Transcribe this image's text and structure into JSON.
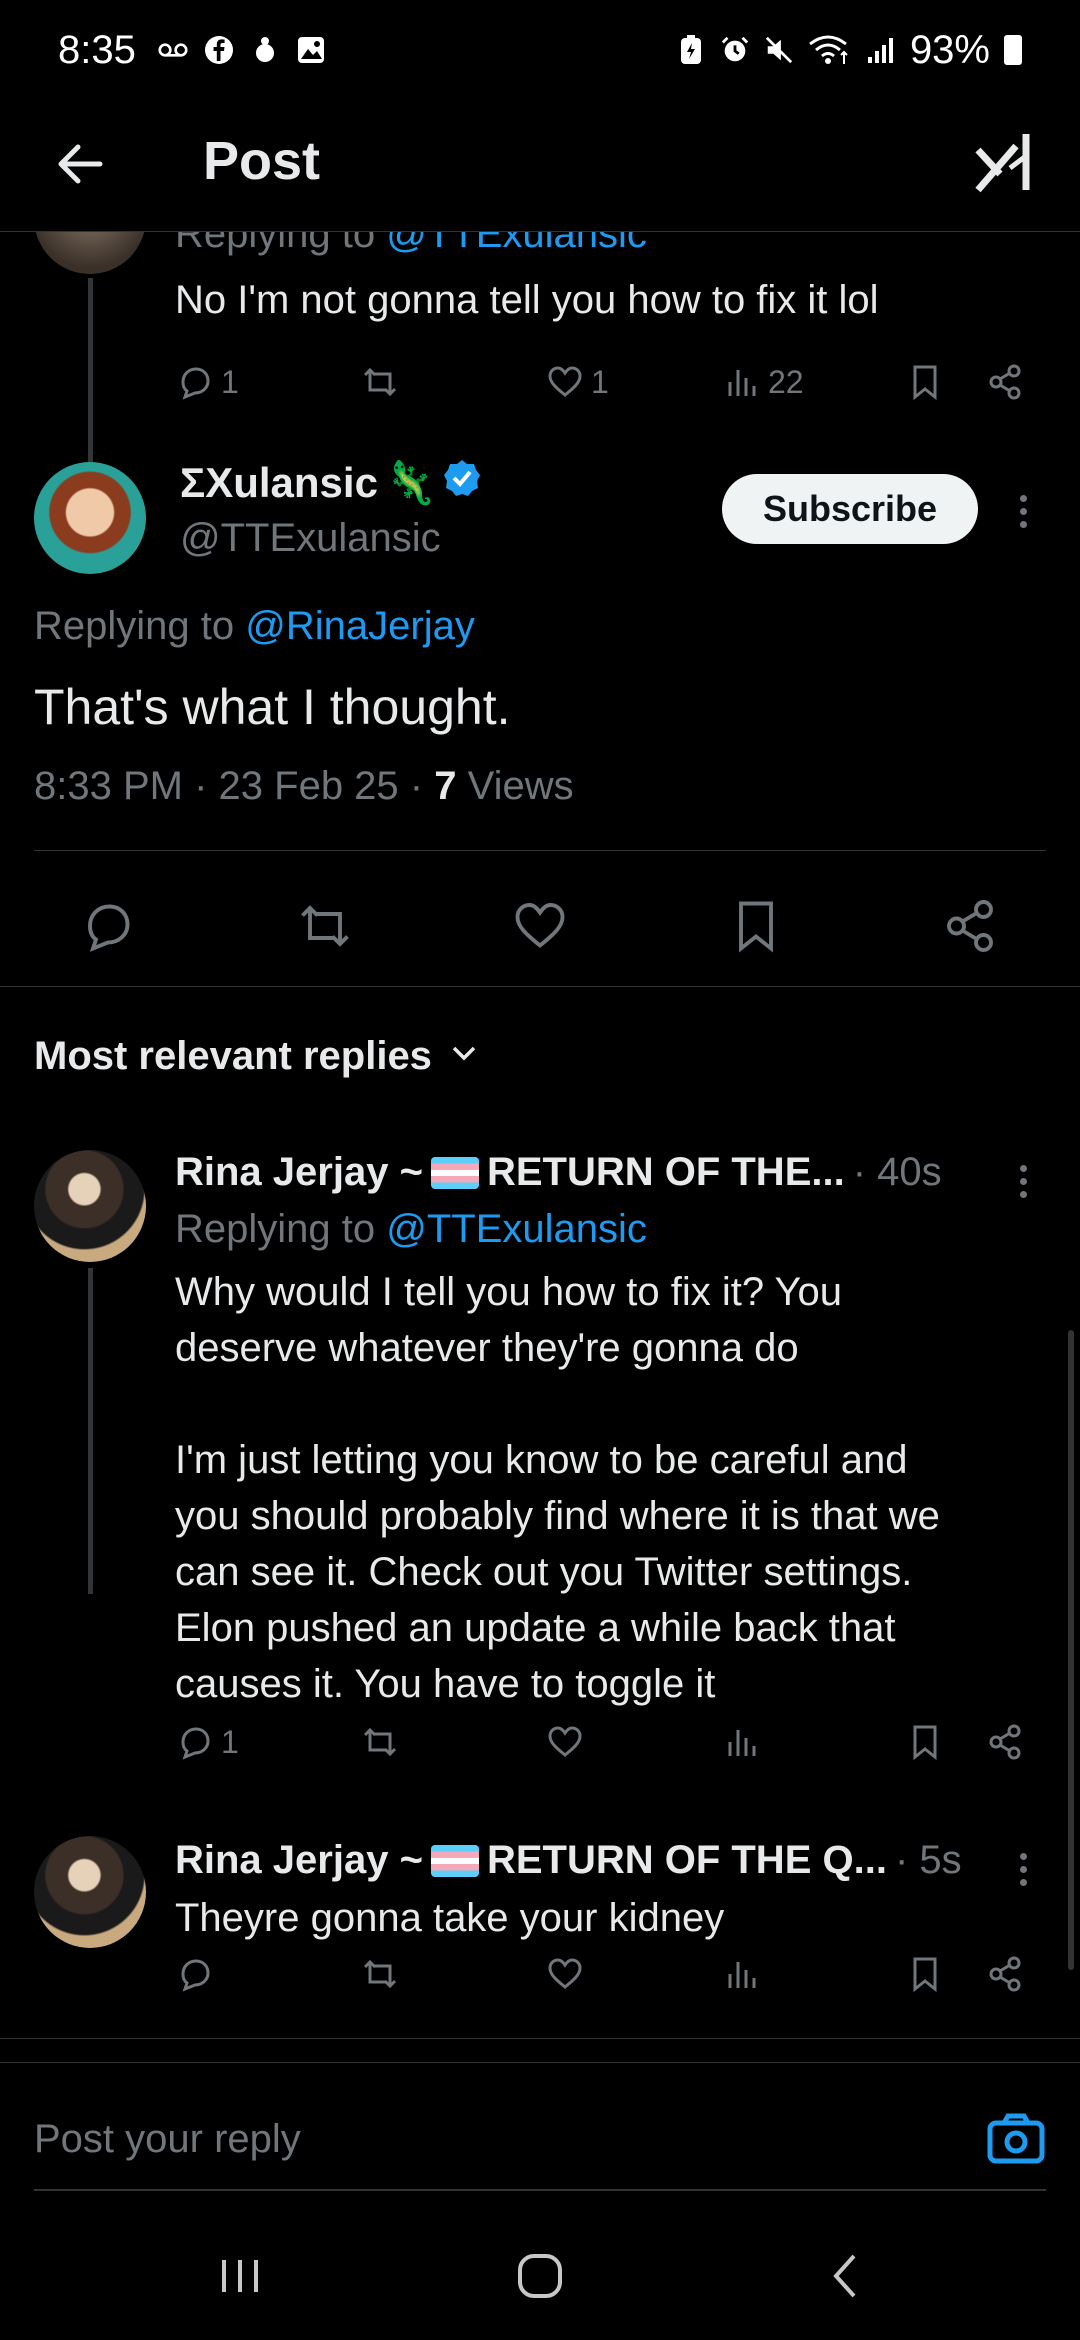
{
  "status_bar": {
    "time": "8:35",
    "battery": "93%",
    "left_icons": [
      "voicemail-icon",
      "facebook-icon",
      "notification-icon",
      "gallery-icon"
    ],
    "right_icons": [
      "battery-saver-icon",
      "alarm-icon",
      "mute-icon",
      "wifi-icon",
      "signal-icon"
    ]
  },
  "app_bar": {
    "title": "Post",
    "back_icon": "arrow-left-icon",
    "grok_icon": "grok-icon"
  },
  "previous_post": {
    "replying_label": "Replying to",
    "replying_handle": "@TTExulansic",
    "text": "No I'm not gonna tell you how to fix it lol",
    "replies": "1",
    "likes": "1",
    "views": "22"
  },
  "main_post": {
    "display_name": "ΣXulansic",
    "emoji": "🦎",
    "handle": "@TTExulansic",
    "subscribe_label": "Subscribe",
    "replying_label": "Replying to",
    "replying_handle": "@RinaJerjay",
    "text": "That's what I thought.",
    "time": "8:33 PM",
    "date": "23 Feb 25",
    "views_count": "7",
    "views_label": "Views"
  },
  "replies_section": {
    "sort_label": "Most relevant replies"
  },
  "replies": [
    {
      "name_start": "Rina Jerjay ~",
      "name_end": "RETURN OF THE...",
      "ago": "· 40s",
      "replying_label": "Replying to",
      "replying_handle": "@TTExulansic",
      "text": "Why would I tell you how to fix it? You\ndeserve whatever they're gonna do\n\nI'm just letting you know to be careful and\nyou should probably find where it is that we\ncan see it. Check out you Twitter settings.\nElon pushed an update a while back that\ncauses it. You have to toggle it",
      "replies": "1"
    },
    {
      "name_start": "Rina Jerjay ~",
      "name_end": "RETURN OF THE Q...",
      "ago": "· 5s",
      "text": "Theyre gonna take your kidney"
    }
  ],
  "composer": {
    "placeholder": "Post your reply"
  },
  "colors": {
    "accent": "#1d9bf0",
    "background": "#000000",
    "muted": "#71767b",
    "text": "#e7e9ea"
  }
}
